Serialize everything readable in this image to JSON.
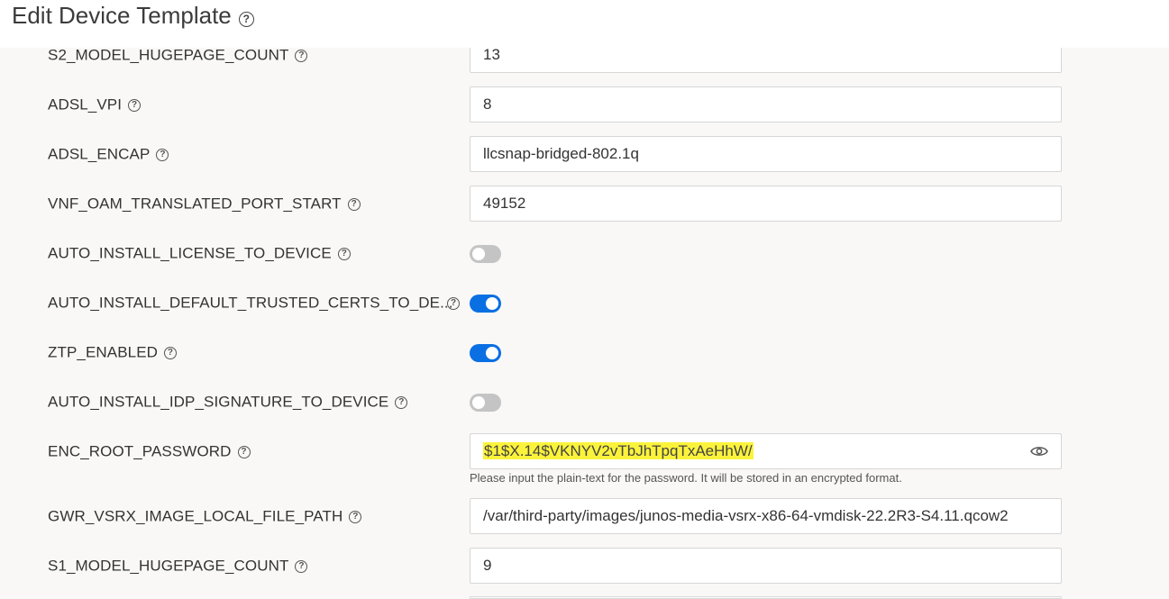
{
  "header": {
    "title": "Edit Device Template"
  },
  "fields": {
    "s2_hugepage": {
      "label": "S2_MODEL_HUGEPAGE_COUNT",
      "value": "13"
    },
    "adsl_vpi": {
      "label": "ADSL_VPI",
      "value": "8"
    },
    "adsl_encap": {
      "label": "ADSL_ENCAP",
      "value": "llcsnap-bridged-802.1q"
    },
    "vnf_oam_port": {
      "label": "VNF_OAM_TRANSLATED_PORT_START",
      "value": "49152"
    },
    "auto_license": {
      "label": "AUTO_INSTALL_LICENSE_TO_DEVICE",
      "enabled": false
    },
    "auto_certs": {
      "label": "AUTO_INSTALL_DEFAULT_TRUSTED_CERTS_TO_DE...",
      "enabled": true
    },
    "ztp": {
      "label": "ZTP_ENABLED",
      "enabled": true
    },
    "auto_idp": {
      "label": "AUTO_INSTALL_IDP_SIGNATURE_TO_DEVICE",
      "enabled": false
    },
    "enc_root_password": {
      "label": "ENC_ROOT_PASSWORD",
      "value": "$1$X.14$VKNYV2vTbJhTpqTxAeHhW/",
      "hint": "Please input the plain-text for the password. It will be stored in an encrypted format."
    },
    "gwr_vsrx_path": {
      "label": "GWR_VSRX_IMAGE_LOCAL_FILE_PATH",
      "value": "/var/third-party/images/junos-media-vsrx-x86-64-vmdisk-22.2R3-S4.11.qcow2"
    },
    "s1_hugepage": {
      "label": "S1_MODEL_HUGEPAGE_COUNT",
      "value": "9"
    }
  },
  "colors": {
    "toggle_on": "#0a6fe3",
    "toggle_off": "#c4c4c4",
    "highlight": "#fbf33b"
  }
}
